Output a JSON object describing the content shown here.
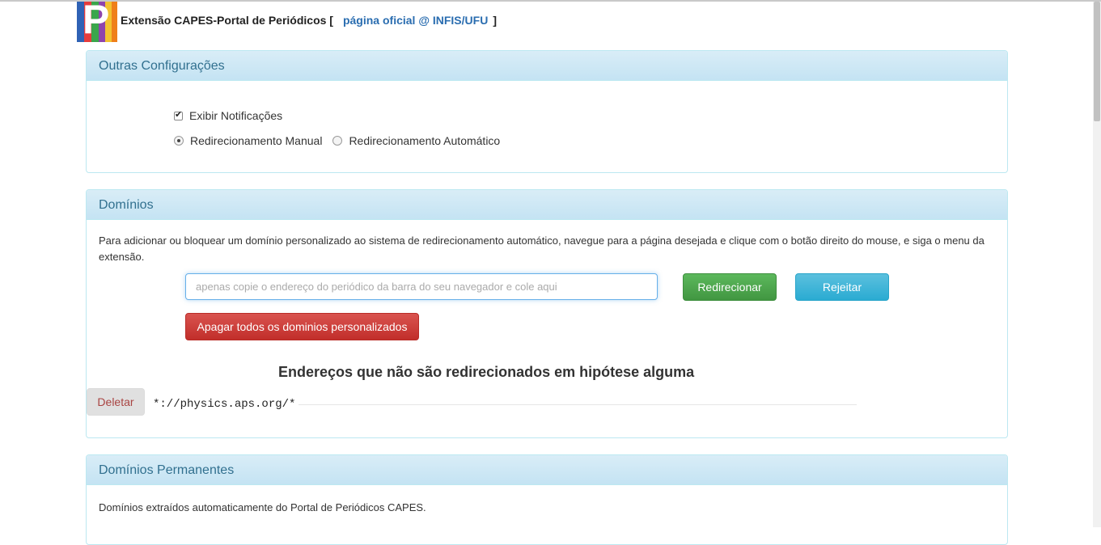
{
  "header": {
    "logo_letter": "P",
    "title": "Extensão CAPES-Portal de Periódicos [",
    "link_text": "página oficial @ INFIS/UFU",
    "close_bracket": "]"
  },
  "colors": {
    "logo_stripes": [
      "#e63c3c",
      "#2f62b5",
      "#3aa64b",
      "#f2c230",
      "#8e44ad",
      "#ef7f1a"
    ],
    "panel_heading_text": "#31708f",
    "success": "#5cb85c",
    "info": "#5bc0de",
    "danger": "#d9534f"
  },
  "other_settings": {
    "heading": "Outras Configurações",
    "show_notifications_label": "Exibir Notificações",
    "show_notifications_checked": true,
    "manual_redirect_label": "Redirecionamento Manual",
    "manual_redirect_selected": true,
    "auto_redirect_label": "Redirecionamento Automático",
    "auto_redirect_selected": false
  },
  "domains": {
    "heading": "Domínios",
    "description": "Para adicionar ou bloquear um domínio personalizado ao sistema de redirecionamento automático, navegue para a página desejada e clique com o botão direito do mouse, e siga o menu da extensão.",
    "input_placeholder": "apenas copie o endereço do periódico da barra do seu navegador e cole aqui",
    "redirect_button": "Redirecionar",
    "reject_button": "Rejeitar",
    "clear_all_button": "Apagar todos os dominios personalizados",
    "excluded_title": "Endereços que não são redirecionados em hipótese alguma",
    "excluded": [
      {
        "delete_label": "Deletar",
        "pattern": "*://physics.aps.org/*"
      }
    ]
  },
  "permanent_domains": {
    "heading": "Domínios Permanentes",
    "description": "Domínios extraídos automaticamente do Portal de Periódicos CAPES."
  }
}
